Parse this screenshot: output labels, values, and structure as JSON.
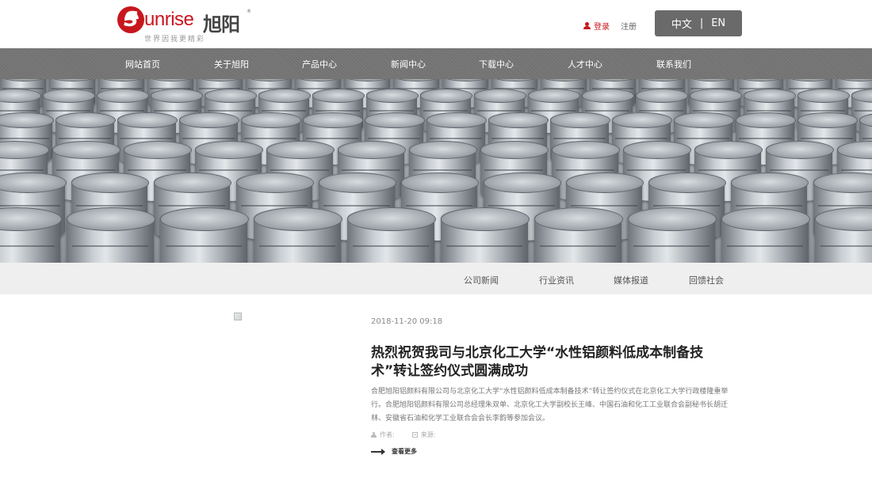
{
  "header": {
    "logo": {
      "word": "unrise",
      "initial": "S",
      "cn": "旭阳",
      "tm": "®",
      "slogan": "世界因我更精彩"
    },
    "login": "登录",
    "register": "注册",
    "lang": {
      "cn": "中文",
      "sep": "|",
      "en": "EN"
    }
  },
  "nav": {
    "items": [
      "网站首页",
      "关于旭阳",
      "产品中心",
      "新闻中心",
      "下载中心",
      "人才中心",
      "联系我们"
    ]
  },
  "subnav": {
    "items": [
      "公司新闻",
      "行业资讯",
      "媒体报道",
      "回馈社会"
    ]
  },
  "article": {
    "date": "2018-11-20 09:18",
    "title": "热烈祝贺我司与北京化工大学“水性铝颜料低成本制备技术”转让签约仪式圆满成功",
    "summary": "合肥旭阳铝颜料有限公司与北京化工大学“水性铝颜料低成本制备技术”转让签约仪式在北京化工大学行政楼隆重举行。合肥旭阳铝颜料有限公司总经理朱双单、北京化工大学副校长王峰、中国石油和化工工业联合会副秘书长胡迁林、安徽省石油和化学工业联合会会长李韵等参加会议。",
    "author_label": "作者:",
    "source_label": "来源:",
    "more": "查看更多"
  },
  "colors": {
    "brand_red": "#c8161d",
    "nav_gray": "#727272",
    "subnav_bg": "#efefef"
  }
}
